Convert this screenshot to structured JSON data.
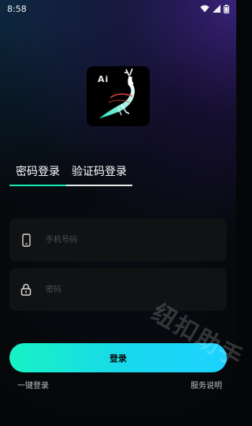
{
  "status_bar": {
    "time": "8:58"
  },
  "logo": {
    "text": "Ai"
  },
  "tabs": [
    {
      "label": "密码登录",
      "active": true
    },
    {
      "label": "验证码登录",
      "active": false
    }
  ],
  "form": {
    "phone_placeholder": "手机号码",
    "password_placeholder": "密码"
  },
  "login_button": {
    "label": "登录"
  },
  "links": {
    "one_click_login": "一键登录",
    "right_text": "服务说明"
  },
  "watermark": {
    "text": "纽扣助手"
  },
  "colors": {
    "accent": "#17e9b0",
    "button_start": "#18f2c5",
    "button_end": "#1dd2ff",
    "background": "#050608",
    "field_bg": "#101213"
  }
}
